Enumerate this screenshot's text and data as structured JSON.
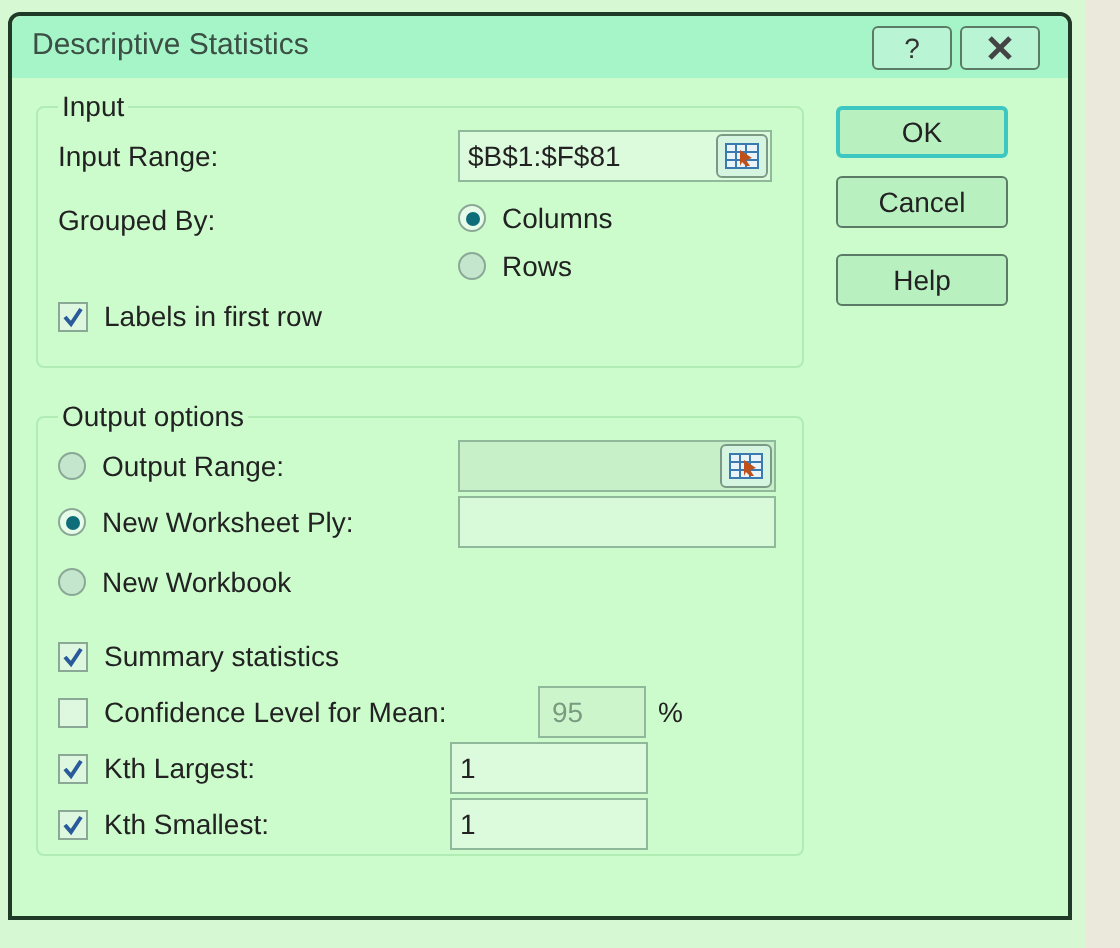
{
  "window": {
    "title": "Descriptive Statistics",
    "help_button": "?"
  },
  "input": {
    "title": "Input",
    "input_range": {
      "label": "Input Range:",
      "value": "$B$1:$F$81"
    },
    "grouped_by": {
      "label": "Grouped By:",
      "options": [
        {
          "label": "Columns",
          "selected": true
        },
        {
          "label": "Rows",
          "selected": false
        }
      ]
    },
    "labels_in_first_row": {
      "label": "Labels in first row",
      "checked": true
    }
  },
  "output": {
    "title": "Output options",
    "destinations": [
      {
        "label": "Output Range:",
        "selected": false,
        "kind": "range"
      },
      {
        "label": "New Worksheet Ply:",
        "selected": true,
        "kind": "text"
      },
      {
        "label": "New Workbook",
        "selected": false,
        "kind": "plain"
      }
    ],
    "options": [
      {
        "kind": "check",
        "label": "Summary statistics",
        "checked": true
      },
      {
        "kind": "percent",
        "label": "Confidence Level for Mean:",
        "checked": false,
        "value": "95",
        "unit": "%"
      },
      {
        "kind": "number",
        "label": "Kth Largest:",
        "checked": true,
        "value": "1"
      },
      {
        "kind": "number",
        "label": "Kth Smallest:",
        "checked": true,
        "value": "1"
      }
    ]
  },
  "buttons": [
    {
      "label": "OK",
      "default": true
    },
    {
      "label": "Cancel",
      "default": false
    },
    {
      "label": "Help",
      "default": false
    }
  ]
}
